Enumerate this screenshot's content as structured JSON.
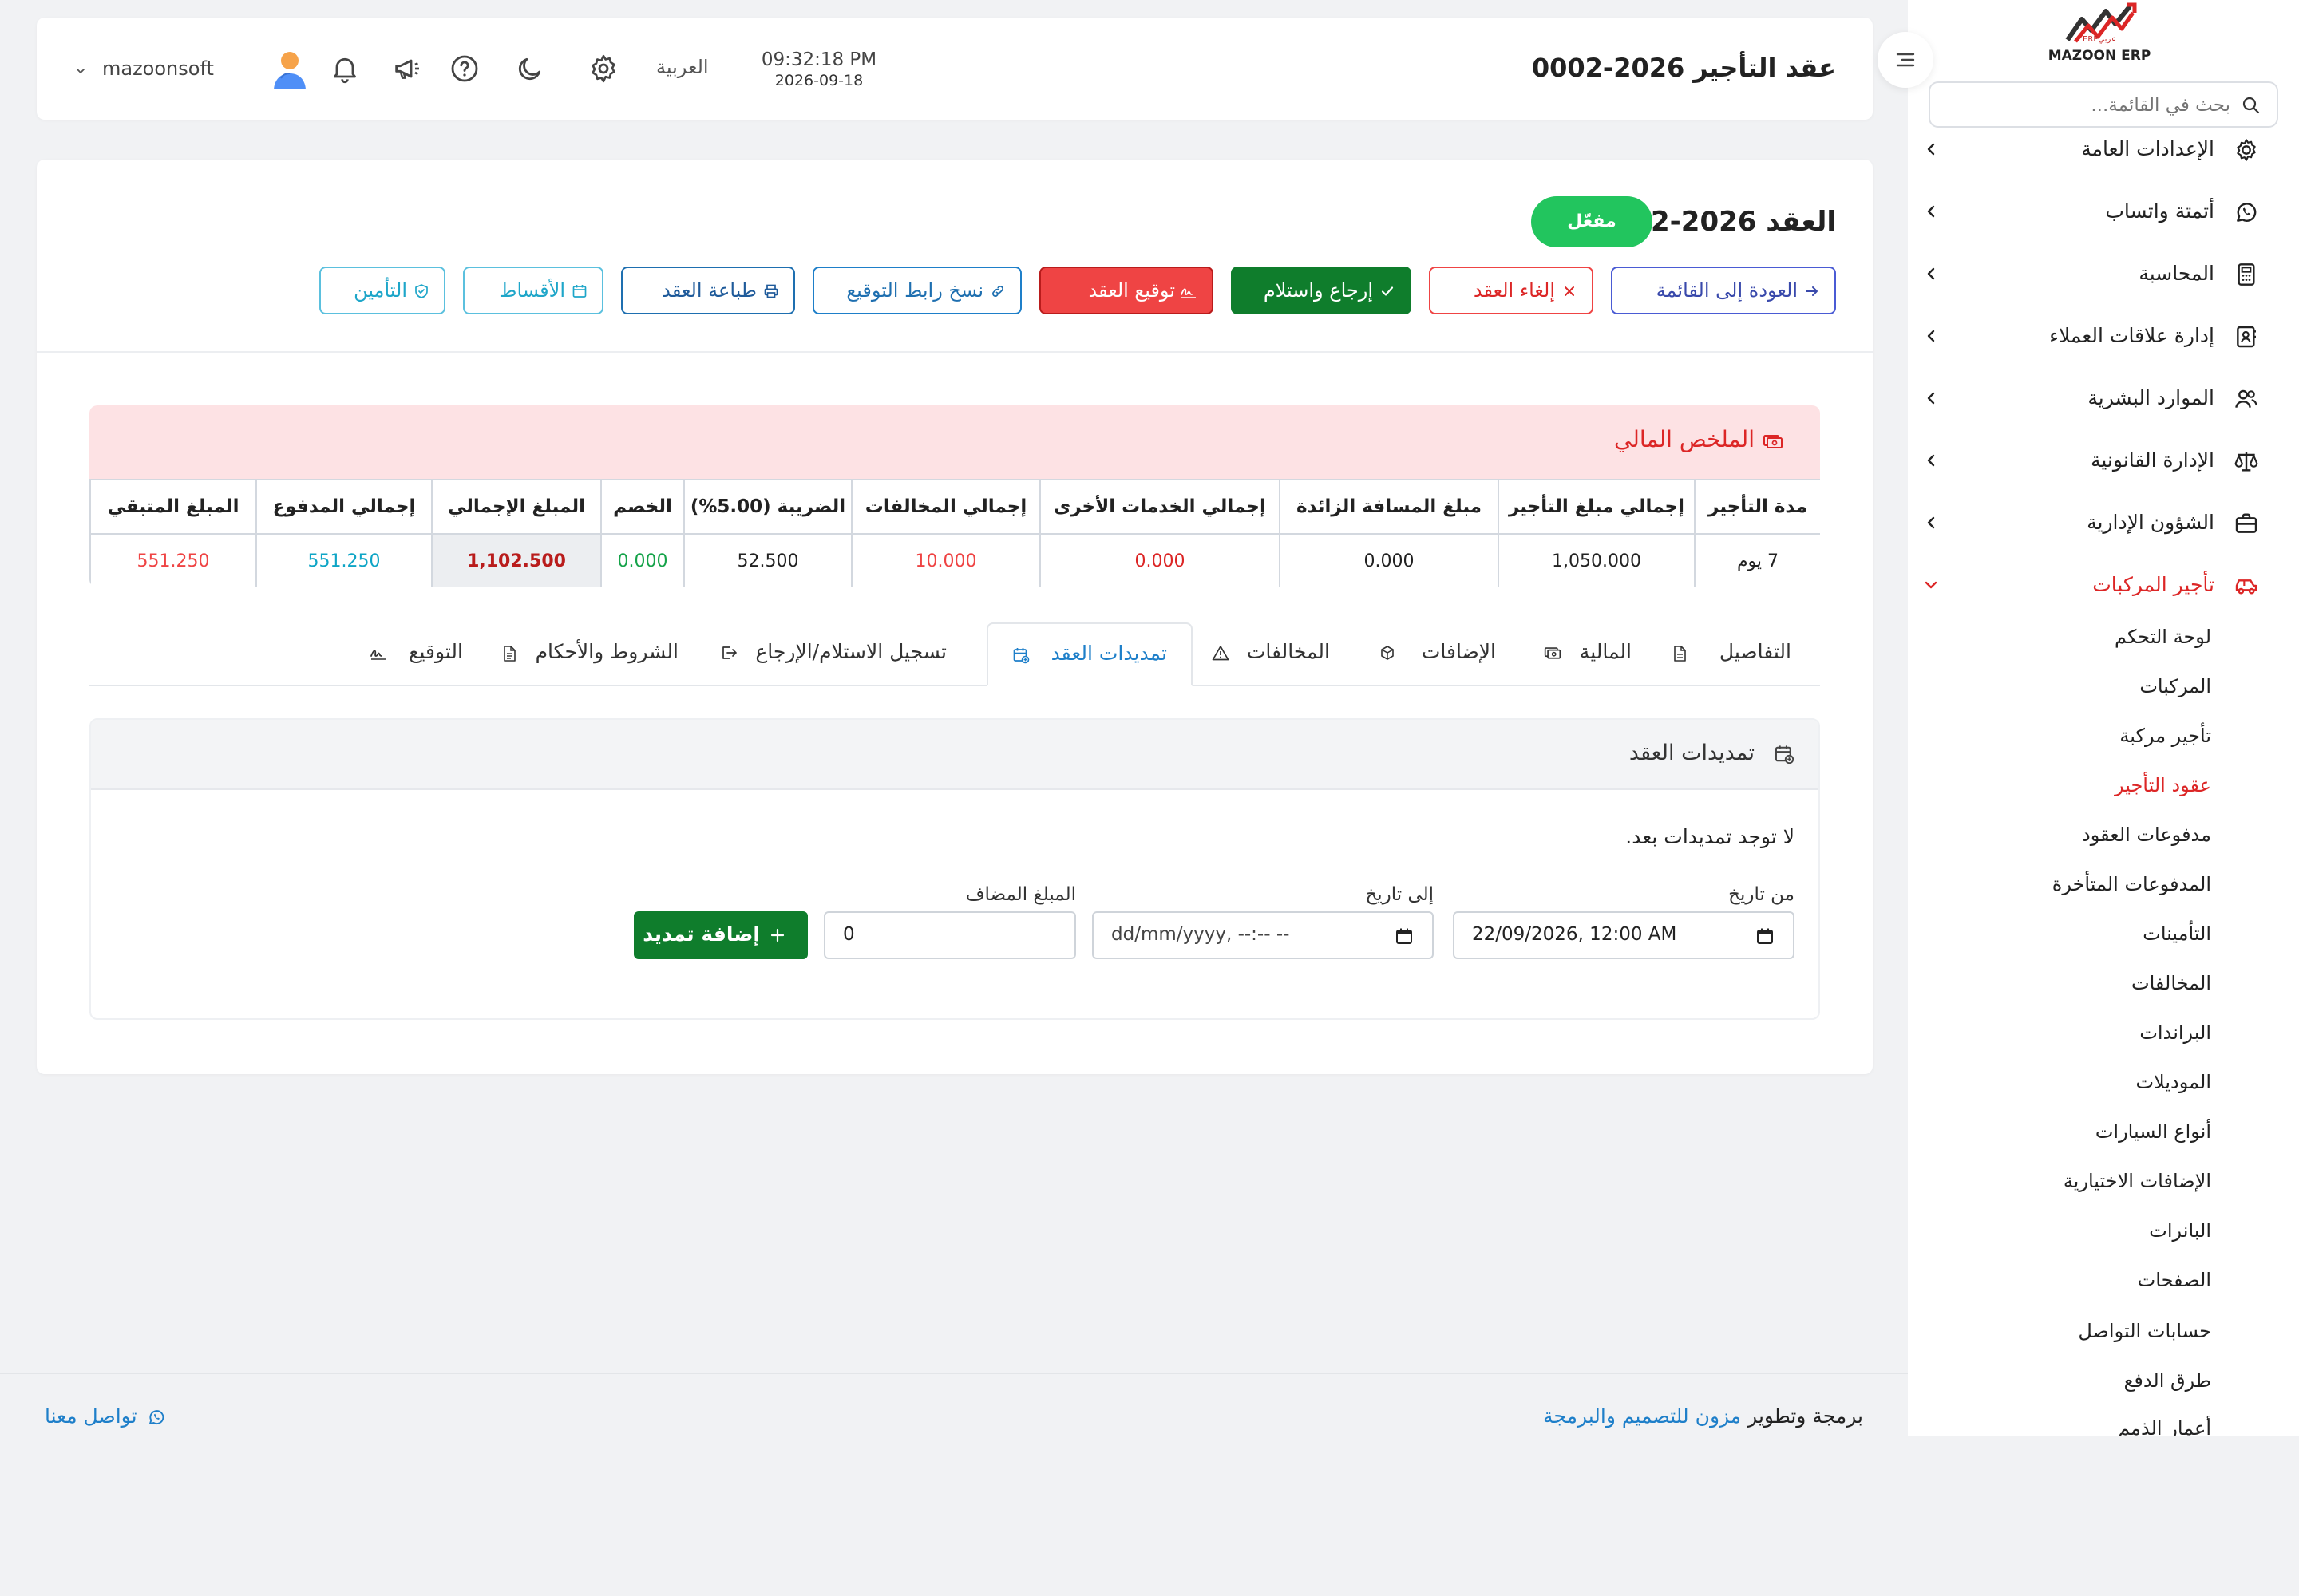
{
  "sidebar": {
    "logo_text": "MAZOON ERP",
    "logo_small": "ERPعربي",
    "search_placeholder": "بحث في القائمة...",
    "menu": [
      {
        "label": "الإعدادات العامة"
      },
      {
        "label": "أتمتة واتساب"
      },
      {
        "label": "المحاسبة"
      },
      {
        "label": "إدارة علاقات العملاء"
      },
      {
        "label": "الموارد البشرية"
      },
      {
        "label": "الإدارة القانونية"
      },
      {
        "label": "الشؤون الإدارية"
      },
      {
        "label": "تأجير المركبات"
      }
    ],
    "submenu": [
      "لوحة التحكم",
      "المركبات",
      "تأجير مركبة",
      "عقود التأجير",
      "مدفوعات العقود",
      "المدفوعات المتأخرة",
      "التأمينات",
      "المخالفات",
      "البراندات",
      "الموديلات",
      "أنواع السيارات",
      "الإضافات الاختيارية",
      "البانرات",
      "الصفحات",
      "حسابات التواصل",
      "طرق الدفع",
      "أعمار الذمم"
    ]
  },
  "header": {
    "title": "عقد التأجير 2026-0002",
    "time": "09:32:18 PM",
    "date": "2026-09-18",
    "language": "العربية",
    "username": "mazoonsoft"
  },
  "contract": {
    "title": "العقد 2026-0002",
    "status": "مفعّل",
    "buttons": {
      "back": "العودة إلى القائمة",
      "cancel": "إلغاء العقد",
      "return": "إرجاع واستلام",
      "sign": "توقيع العقد",
      "copy_link": "نسخ رابط التوقيع",
      "print": "طباعة العقد",
      "installments": "الأقساط",
      "insurance": "التأمين"
    }
  },
  "financial_summary": {
    "title": "الملخص المالي",
    "columns": [
      "مدة التأجير",
      "إجمالي مبلغ التأجير",
      "مبلغ المسافة الزائدة",
      "إجمالي الخدمات الأخرى",
      "إجمالي المخالفات",
      "الضريبة (5.00%)",
      "الخصم",
      "المبلغ الإجمالي",
      "إجمالي المدفوع",
      "المبلغ المتبقي"
    ],
    "values": [
      "7 يوم",
      "1,050.000",
      "0.000",
      "0.000",
      "10.000",
      "52.500",
      "0.000",
      "1,102.500",
      "551.250",
      "551.250"
    ],
    "colors": {
      "red": "#dc2626",
      "green": "#16a34a",
      "teal": "#0ea5c6",
      "dark_red": "#b91c1c"
    }
  },
  "tabs": [
    "التفاصيل",
    "المالية",
    "الإضافات",
    "المخالفات",
    "تمديدات العقد",
    "تسجيل الاستلام/الإرجاع",
    "الشروط والأحكام",
    "التوقيع"
  ],
  "extensions": {
    "title": "تمديدات العقد",
    "empty_message": "لا توجد تمديدات بعد.",
    "from_label": "من تاريخ",
    "from_value": "22/09/2026, 12:00 AM",
    "to_label": "إلى تاريخ",
    "to_placeholder": "dd/mm/yyyy, --:-- --",
    "amount_label": "المبلغ المضاف",
    "amount_value": "0",
    "add_button": "إضافة تمديد"
  },
  "footer": {
    "credit_prefix": "برمجة وتطوير",
    "credit_link": "مزون للتصميم والبرمجة",
    "contact": "تواصل معنا"
  }
}
